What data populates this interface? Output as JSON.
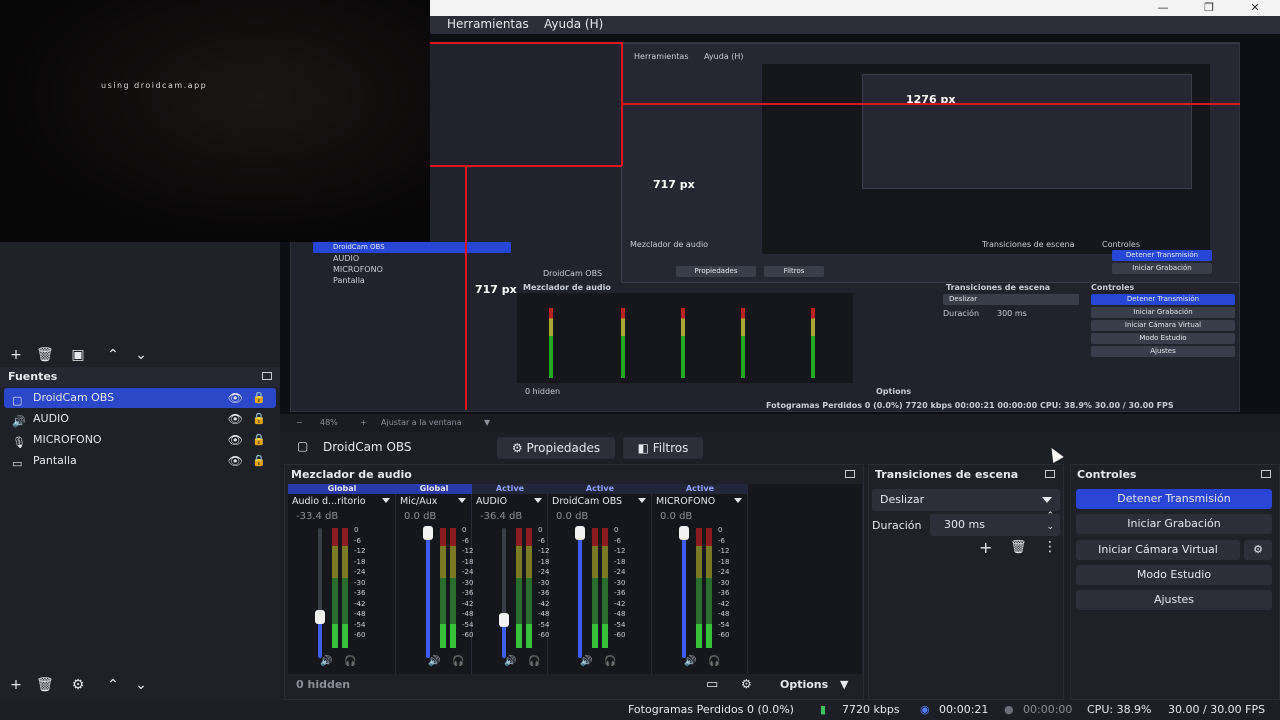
{
  "window": {
    "menu": [
      "Herramientas",
      "Ayuda (H)"
    ],
    "controls": {
      "minimize": "—",
      "maximize": "❐",
      "close": "✕"
    }
  },
  "droidcam": {
    "watermark": "using droidcam.app"
  },
  "preview": {
    "px_width": "1276 px",
    "px_height": "717 px",
    "nested_menu": [
      "Herramientas",
      "Ayuda (H)"
    ],
    "zoom": "48%",
    "zoom_fit": "Ajustar a la ventana",
    "nested_sources": [
      "DroidCam OBS",
      "AUDIO",
      "MICROFONO",
      "Pantalla"
    ],
    "nested_props": "Propiedades",
    "nested_filters": "Filtros",
    "nested_mixer_title": "Mezclador de audio",
    "nested_transitions_title": "Transiciones de escena",
    "nested_controls_title": "Controles",
    "nested_status": "Fotogramas Perdidos 0 (0.0%)   7720 kbps   00:00:21   00:00:00   CPU: 38.9%   30.00 / 30.00 FPS",
    "nested_hidden": "0 hidden",
    "nested_options": "Options",
    "nested_controls": [
      "Detener Transmisión",
      "Iniciar Grabación",
      "Iniciar Cámara Virtual",
      "Modo Estudio",
      "Ajustes"
    ],
    "nested_deslizar": "Deslizar",
    "nested_duracion": "Duración",
    "nested_ms": "300 ms"
  },
  "sources": {
    "title": "Fuentes",
    "items": [
      {
        "label": "DroidCam OBS",
        "icon": "camera-icon",
        "selected": true
      },
      {
        "label": "AUDIO",
        "icon": "speaker-icon",
        "selected": false
      },
      {
        "label": "MICROFONO",
        "icon": "microphone-icon",
        "selected": false
      },
      {
        "label": "Pantalla",
        "icon": "monitor-icon",
        "selected": false
      }
    ]
  },
  "source_bar": {
    "selected": "DroidCam OBS",
    "properties": "Propiedades",
    "filters": "Filtros"
  },
  "mixer": {
    "title": "Mezclador de audio",
    "channels": [
      {
        "status": "Global",
        "name": "Audio d...ritorio",
        "db": "-33.4 dB",
        "level": 0.35
      },
      {
        "status": "Global",
        "name": "Mic/Aux",
        "db": "0.0 dB",
        "level": 1.0
      },
      {
        "status": "Active",
        "name": "AUDIO",
        "db": "-36.4 dB",
        "level": 0.33
      },
      {
        "status": "Active",
        "name": "DroidCam OBS",
        "db": "0.0 dB",
        "level": 1.0
      },
      {
        "status": "Active",
        "name": "MICROFONO",
        "db": "0.0 dB",
        "level": 1.0
      }
    ],
    "scale": [
      "0",
      "-6",
      "-12",
      "-18",
      "-24",
      "-30",
      "-36",
      "-42",
      "-48",
      "-54",
      "-60"
    ],
    "hidden": "0 hidden",
    "options": "Options"
  },
  "transitions": {
    "title": "Transiciones de escena",
    "selected": "Deslizar",
    "duration_label": "Duración",
    "duration_value": "300 ms"
  },
  "controls": {
    "title": "Controles",
    "stop_stream": "Detener Transmisión",
    "start_record": "Iniciar Grabación",
    "virtual_cam": "Iniciar Cámara Virtual",
    "studio_mode": "Modo Estudio",
    "settings": "Ajustes"
  },
  "status": {
    "dropped_frames": "Fotogramas Perdidos 0 (0.0%)",
    "bitrate": "7720 kbps",
    "stream_time": "00:00:21",
    "record_time": "00:00:00",
    "cpu": "CPU: 38.9%",
    "fps": "30.00 / 30.00 FPS"
  },
  "colors": {
    "accent": "#2a44d6",
    "selection": "#2c48c8",
    "red_guide": "#e0141e"
  }
}
